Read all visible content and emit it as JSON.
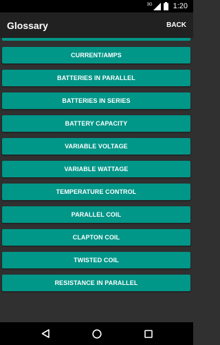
{
  "status_bar": {
    "network_label": "3G",
    "time": "1:20"
  },
  "app_bar": {
    "title": "Glossary",
    "back_label": "BACK"
  },
  "glossary": {
    "items": [
      {
        "label": "CURRENT/AMPS"
      },
      {
        "label": "BATTERIES IN PARALLEL"
      },
      {
        "label": "BATTERIES IN SERIES"
      },
      {
        "label": "BATTERY CAPACITY"
      },
      {
        "label": "VARIABLE VOLTAGE"
      },
      {
        "label": "VARIABLE WATTAGE"
      },
      {
        "label": "TEMPERATURE CONTROL"
      },
      {
        "label": "PARALLEL COIL"
      },
      {
        "label": "CLAPTON COIL"
      },
      {
        "label": "TWISTED COIL"
      },
      {
        "label": "RESISTANCE IN PARALLEL"
      }
    ]
  },
  "nav_bar": {
    "icons": [
      "back-triangle-icon",
      "home-circle-icon",
      "recents-square-icon"
    ]
  },
  "colors": {
    "accent": "#009688",
    "background": "#303030",
    "app_bar": "#212121",
    "system_bars": "#000000"
  }
}
